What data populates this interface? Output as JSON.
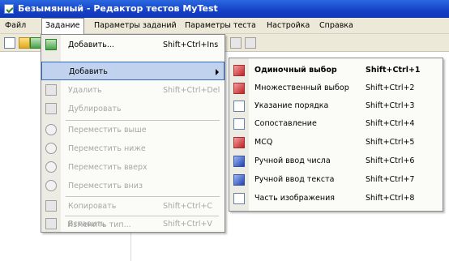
{
  "window": {
    "title": "Безымянный - Редактор тестов MyTest"
  },
  "menubar": [
    {
      "label": "Файл"
    },
    {
      "label": "Задание"
    },
    {
      "label": "Параметры заданий"
    },
    {
      "label": "Параметры теста"
    },
    {
      "label": "Настройка"
    },
    {
      "label": "Справка"
    }
  ],
  "task_menu": [
    {
      "label": "Добавить...",
      "shortcut": "Shift+Ctrl+Ins",
      "icon": "add-task-icon",
      "state": "normal"
    },
    {
      "label": "Добавить",
      "shortcut": "",
      "icon": "",
      "state": "highlighted",
      "submenu": true
    },
    {
      "label": "Удалить",
      "shortcut": "Shift+Ctrl+Del",
      "icon": "delete-task-icon",
      "state": "disabled"
    },
    {
      "label": "Дублировать",
      "shortcut": "",
      "icon": "duplicate-task-icon",
      "state": "disabled"
    },
    {
      "label": "Переместить выше",
      "shortcut": "",
      "icon": "move-up-icon",
      "state": "disabled"
    },
    {
      "label": "Переместить ниже",
      "shortcut": "",
      "icon": "move-down-icon",
      "state": "disabled"
    },
    {
      "label": "Переместить вверх",
      "shortcut": "",
      "icon": "move-top-icon",
      "state": "disabled"
    },
    {
      "label": "Переместить вниз",
      "shortcut": "",
      "icon": "move-bottom-icon",
      "state": "disabled"
    },
    {
      "label": "Копировать",
      "shortcut": "Shift+Ctrl+C",
      "icon": "copy-icon",
      "state": "disabled"
    },
    {
      "label": "Вставить",
      "shortcut": "Shift+Ctrl+V",
      "icon": "paste-icon",
      "state": "disabled"
    },
    {
      "label": "Изменить тип...",
      "shortcut": "",
      "icon": "",
      "state": "disabled"
    }
  ],
  "add_submenu": [
    {
      "label": "Одиночный выбор",
      "shortcut": "Shift+Ctrl+1",
      "icon": "single-choice-icon",
      "bold": true
    },
    {
      "label": "Множественный выбор",
      "shortcut": "Shift+Ctrl+2",
      "icon": "multiple-choice-icon"
    },
    {
      "label": "Указание порядка",
      "shortcut": "Shift+Ctrl+3",
      "icon": "ordering-icon"
    },
    {
      "label": "Сопоставление",
      "shortcut": "Shift+Ctrl+4",
      "icon": "matching-icon"
    },
    {
      "label": "MCQ",
      "shortcut": "Shift+Ctrl+5",
      "icon": "mcq-icon"
    },
    {
      "label": "Ручной ввод числа",
      "shortcut": "Shift+Ctrl+6",
      "icon": "number-input-icon"
    },
    {
      "label": "Ручной ввод текста",
      "shortcut": "Shift+Ctrl+7",
      "icon": "text-input-icon"
    },
    {
      "label": "Часть изображения",
      "shortcut": "Shift+Ctrl+8",
      "icon": "image-area-icon"
    }
  ],
  "colors": {
    "titlebar": "#1541c6",
    "highlight": "#c1d2ee",
    "highlight_border": "#316ac5",
    "disabled_text": "#a7a7a7"
  }
}
